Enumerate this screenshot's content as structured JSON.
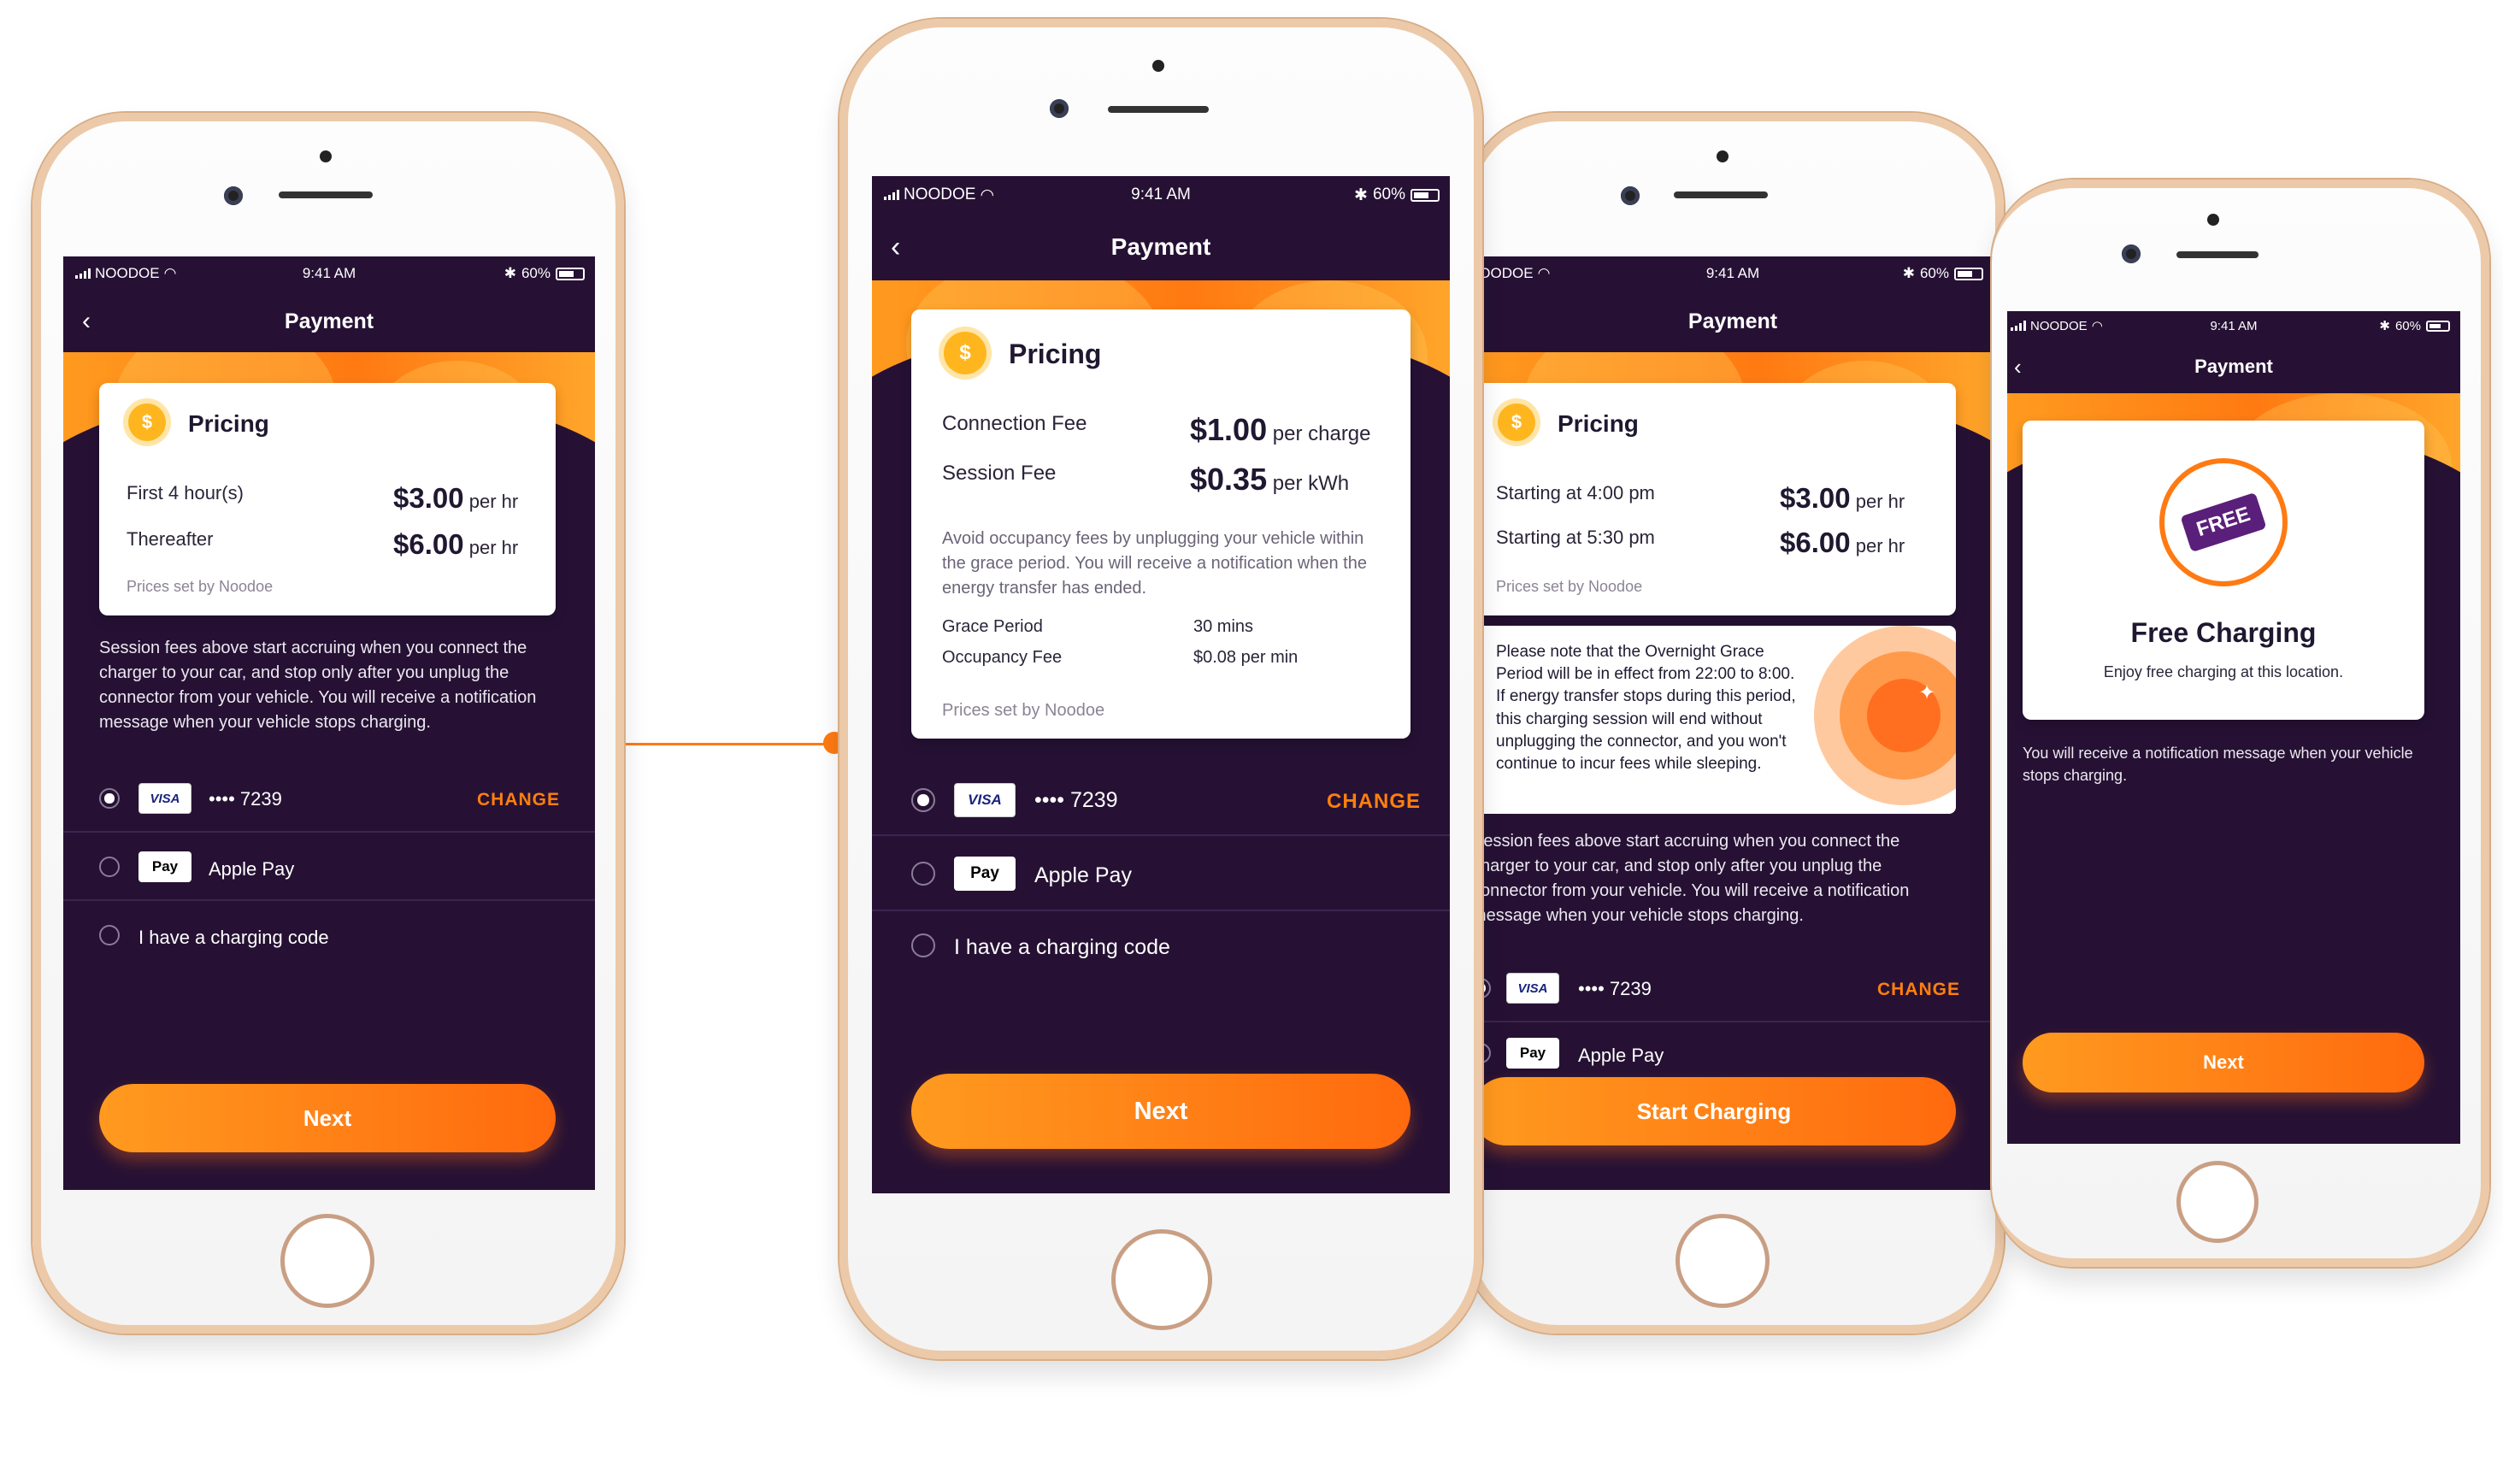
{
  "status": {
    "carrier": "NOODOE",
    "time": "9:41 AM",
    "battery": "60%"
  },
  "nav": {
    "title": "Payment",
    "back_icon": "chevron-left-icon"
  },
  "colors": {
    "background": "#261134",
    "accent": "#ff7a12",
    "card": "#ffffff"
  },
  "phone1": {
    "pricing_title": "Pricing",
    "rows": [
      {
        "label": "First 4 hour(s)",
        "amount": "$3.00",
        "unit": "per hr"
      },
      {
        "label": "Thereafter",
        "amount": "$6.00",
        "unit": "per hr"
      }
    ],
    "prices_note": "Prices set by Noodoe",
    "description": "Session fees above start accruing when you connect the charger to your car, and stop only after you unplug the connector from your vehicle. You will receive a notification message when your vehicle stops charging.",
    "card_brand": "VISA",
    "card_number": "•••• 7239",
    "change": "CHANGE",
    "apple_badge": "Pay",
    "apple_pay": "Apple Pay",
    "code_option": "I have a charging code",
    "next": "Next"
  },
  "phone2": {
    "pricing_title": "Pricing",
    "rows": [
      {
        "label": "Connection Fee",
        "amount": "$1.00",
        "unit": "per charge"
      },
      {
        "label": "Session Fee",
        "amount": "$0.35",
        "unit": "per kWh"
      }
    ],
    "occupancy_note": "Avoid occupancy fees by unplugging your vehicle within the grace period. You will receive a notification when the energy transfer has ended.",
    "grace_label": "Grace Period",
    "grace_value": "30 mins",
    "occupancy_label": "Occupancy Fee",
    "occupancy_value": "$0.08 per min",
    "prices_note": "Prices set by Noodoe",
    "card_brand": "VISA",
    "card_number": "•••• 7239",
    "change": "CHANGE",
    "apple_badge": "Pay",
    "apple_pay": "Apple Pay",
    "code_option": "I have a charging code",
    "next": "Next"
  },
  "phone3": {
    "pricing_title": "Pricing",
    "rows": [
      {
        "label": "Starting at 4:00 pm",
        "amount": "$3.00",
        "unit": "per hr"
      },
      {
        "label": "Starting at 5:30 pm",
        "amount": "$6.00",
        "unit": "per hr"
      }
    ],
    "prices_note": "Prices set by Noodoe",
    "overnight_note": "Please note that the Overnight Grace Period will be in effect from 22:00 to 8:00. If energy transfer stops during this period, this charging session will end without unplugging the connector, and you won't continue to incur fees while sleeping.",
    "description": "Session fees above start accruing when you connect the charger to your car, and stop only after you unplug the connector from your vehicle. You will receive a notification message when your vehicle stops charging.",
    "card_brand": "VISA",
    "card_number": "•••• 7239",
    "change": "CHANGE",
    "apple_badge": "Pay",
    "apple_pay": "Apple Pay",
    "start": "Start Charging"
  },
  "phone4": {
    "free_badge": "FREE",
    "free_title": "Free Charging",
    "free_subtitle": "Enjoy free charging at this location.",
    "description": "You will receive a notification message when your vehicle stops charging.",
    "next": "Next"
  }
}
